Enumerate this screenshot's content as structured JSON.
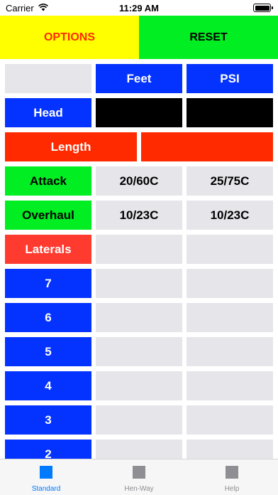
{
  "status_bar": {
    "carrier": "Carrier",
    "time": "11:29 AM"
  },
  "top_buttons": {
    "options": "OPTIONS",
    "reset": "RESET"
  },
  "header": {
    "feet": "Feet",
    "psi": "PSI"
  },
  "rows": {
    "head": "Head",
    "length": "Length",
    "attack": {
      "label": "Attack",
      "feet": "20/60C",
      "psi": "25/75C"
    },
    "overhaul": {
      "label": "Overhaul",
      "feet": "10/23C",
      "psi": "10/23C"
    },
    "laterals": "Laterals"
  },
  "lateral_rows": [
    "7",
    "6",
    "5",
    "4",
    "3",
    "2"
  ],
  "tabs": [
    {
      "label": "Standard",
      "icon": "square-icon",
      "active": true
    },
    {
      "label": "Hen-Way",
      "icon": "square-icon",
      "active": false
    },
    {
      "label": "Help",
      "icon": "square-icon",
      "active": false
    }
  ],
  "colors": {
    "yellow": "#ffff00",
    "green": "#00ee22",
    "blue": "#0433ff",
    "red": "#ff2a00",
    "salmon": "#ff3b30",
    "gray": "#e5e5ea",
    "tab_active": "#007aff"
  }
}
